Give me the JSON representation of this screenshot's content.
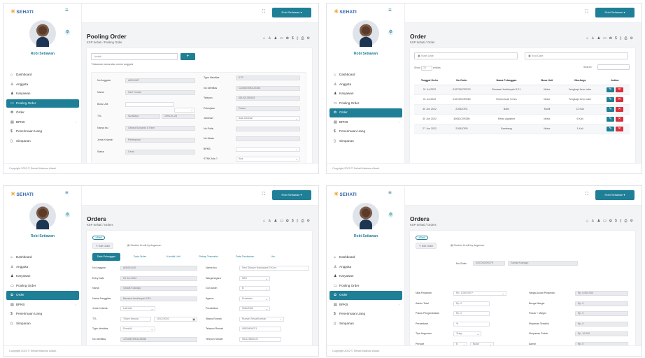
{
  "common": {
    "brand": "SEHATI",
    "user_name": "Robi Setiawan",
    "user_button": "Robi Setiawan",
    "footer": "Copyright 2022 © Sehati Makmur Abadi.",
    "menu": [
      "Dashboard",
      "Anggota",
      "Karyawan",
      "Pooling Order",
      "Order",
      "BPKB",
      "Penerimaan Uang",
      "Simpanan"
    ],
    "menu_icons": [
      "home-icon",
      "users-icon",
      "user-tie-icon",
      "monitor-icon",
      "gear-icon",
      "wallet-icon",
      "dollar-icon",
      "file-icon"
    ],
    "accent": "#1f7f96",
    "danger": "#d9303d"
  },
  "p1": {
    "title": "Pooling Order",
    "breadcrumb": "KSP Sehati / Pooling Order",
    "search_value": "Indah",
    "search_hint": "* Masukan nama atau nomor anggota",
    "left_fields": [
      {
        "label": "No Anggota",
        "value": "A0001087"
      },
      {
        "label": "Nama",
        "value": "Sani Yundal"
      },
      {
        "label": "Buss Unit",
        "value": ""
      },
      {
        "label": "TTL",
        "value": "Surabaya"
      },
      {
        "label": "Nama Ibu",
        "value": "Celsea Suryanto S.Farm"
      },
      {
        "label": "Jenis Kelamin",
        "value": "Perempuan"
      },
      {
        "label": "Status",
        "value": "Cerai"
      }
    ],
    "ttl_date": "1994-01-28",
    "right_fields": [
      {
        "label": "Type Identitas",
        "value": "KTP"
      },
      {
        "label": "No Identitas",
        "value": "1234567890123456"
      },
      {
        "label": "Telepon",
        "value": "081321385183"
      },
      {
        "label": "Pekerjaan",
        "value": "Petani"
      },
      {
        "label": "Jaminan",
        "value": "Ada Jaminan"
      },
      {
        "label": "No Polisi",
        "value": ""
      },
      {
        "label": "No Mesin",
        "value": ""
      },
      {
        "label": "BPKB",
        "value": ""
      },
      {
        "label": "STNK Ada ?",
        "value": "Ada"
      }
    ]
  },
  "p2": {
    "title": "Order",
    "breadcrumb": "KSP Sehati / Order",
    "start_date": "Start Date",
    "end_date": "End Date",
    "show_label": "Show",
    "show_value": "10",
    "entries_label": "entries",
    "search_label": "Search:",
    "columns": [
      "Tanggal Order",
      "No Order",
      "Nama Pelanggan",
      "Buss Unit",
      "Jika Angs",
      "Action"
    ],
    "rows": [
      [
        "01 Jul 2022",
        "0107202OR279",
        "Benawa Herdianyah S.E.I",
        "Motor",
        "*lengkapi form order"
      ],
      [
        "01 Jul 2022",
        "0107202OR280",
        "Rohim Azizi S.Kes",
        "Motor",
        "*lengkapi form order"
      ],
      [
        "30 Jun 2022",
        "21062OR1",
        "Barin",
        "Mobil",
        "12 Kali"
      ],
      [
        "30 Jun 2022",
        "30062O2R280",
        "Restu Agustine",
        "Motor",
        "6 Kali"
      ],
      [
        "27 Jun 2022",
        "21062OR0",
        "Bambang",
        "Motor",
        "1 Kali"
      ]
    ]
  },
  "p3": {
    "title": "Orders",
    "breadcrumb": "KSP Sehati / Orders",
    "back": "◂ Back",
    "sub_tabs": [
      "Edit Order",
      "Struktur Kredit by Angsuran"
    ],
    "tabs": [
      "Data Pelanggan",
      "Data Order",
      "Kondisi Unit",
      "Rekap Transaksi",
      "Data Tambahan",
      "Lks"
    ],
    "left_fields": [
      {
        "label": "No Anggota",
        "value": "A00004125"
      },
      {
        "label": "Entry Date",
        "value": "25 Jun 2022"
      },
      {
        "label": "Nama",
        "value": "Ganda Kusnago"
      },
      {
        "label": "Nama Panggilan",
        "value": "Benawa Herdianyah S.E.I"
      },
      {
        "label": "Jenis Kelamin",
        "value": "Laki laki"
      },
      {
        "label": "TTL",
        "value": "Tidore Kepula"
      },
      {
        "label": "Type Identitas",
        "value": "Domisili"
      },
      {
        "label": "No Identitas",
        "value": "12345678901234566"
      }
    ],
    "ttl_date": "10/12/2002",
    "right_fields": [
      {
        "label": "Nama Ibu",
        "value": "Sesi Shanze Handayani S.Kom"
      },
      {
        "label": "Warganegara",
        "value": "WNI"
      },
      {
        "label": "Gol Darah",
        "value": "B"
      },
      {
        "label": "Agama",
        "value": "Protestan"
      },
      {
        "label": "Pendidikan",
        "value": "SMA/SMK"
      },
      {
        "label": "Status Rumah",
        "value": "Rumah Sewa/Kontrak"
      },
      {
        "label": "Telepon Rumah",
        "value": "08529609071"
      },
      {
        "label": "Telepon Seluler",
        "value": "081123882321"
      }
    ]
  },
  "p4": {
    "title": "Orders",
    "breadcrumb": "KSP Sehati / Orders",
    "back": "◂ Back",
    "sub_tabs": [
      "Edit Order",
      "Struktur Kredit by Angsuran"
    ],
    "no_order_label": "No Order",
    "no_order_value": "0107202OR279",
    "customer": "Ganda Kusnago",
    "left_fields": [
      {
        "label": "Nilai Pinjaman",
        "value": "Rp. 1.000.000 *"
      },
      {
        "label": "Admin Total",
        "value": "Rp. 0"
      },
      {
        "label": "Pokok Pengembalian",
        "value": "Rp. 0"
      },
      {
        "label": "Persentase",
        "value": "%"
      },
      {
        "label": "Tipe Angsuran",
        "value": "Tetap"
      },
      {
        "label": "Periode",
        "value": "$"
      }
    ],
    "period_unit": "Bulan",
    "right_fields": [
      {
        "label": "Harga Acuan Pinjaman",
        "value": "Rp. 6.000.000"
      },
      {
        "label": "Bunga Margin",
        "value": "Rp. 0"
      },
      {
        "label": "Pokok + Margin",
        "value": "Rp. 0"
      },
      {
        "label": "Pinjaman Terakhir",
        "value": "Rp. 0"
      },
      {
        "label": "Simpanan Pokok",
        "value": "Rp. 10.000"
      },
      {
        "label": "Admin",
        "value": "Rp. 0"
      }
    ]
  }
}
